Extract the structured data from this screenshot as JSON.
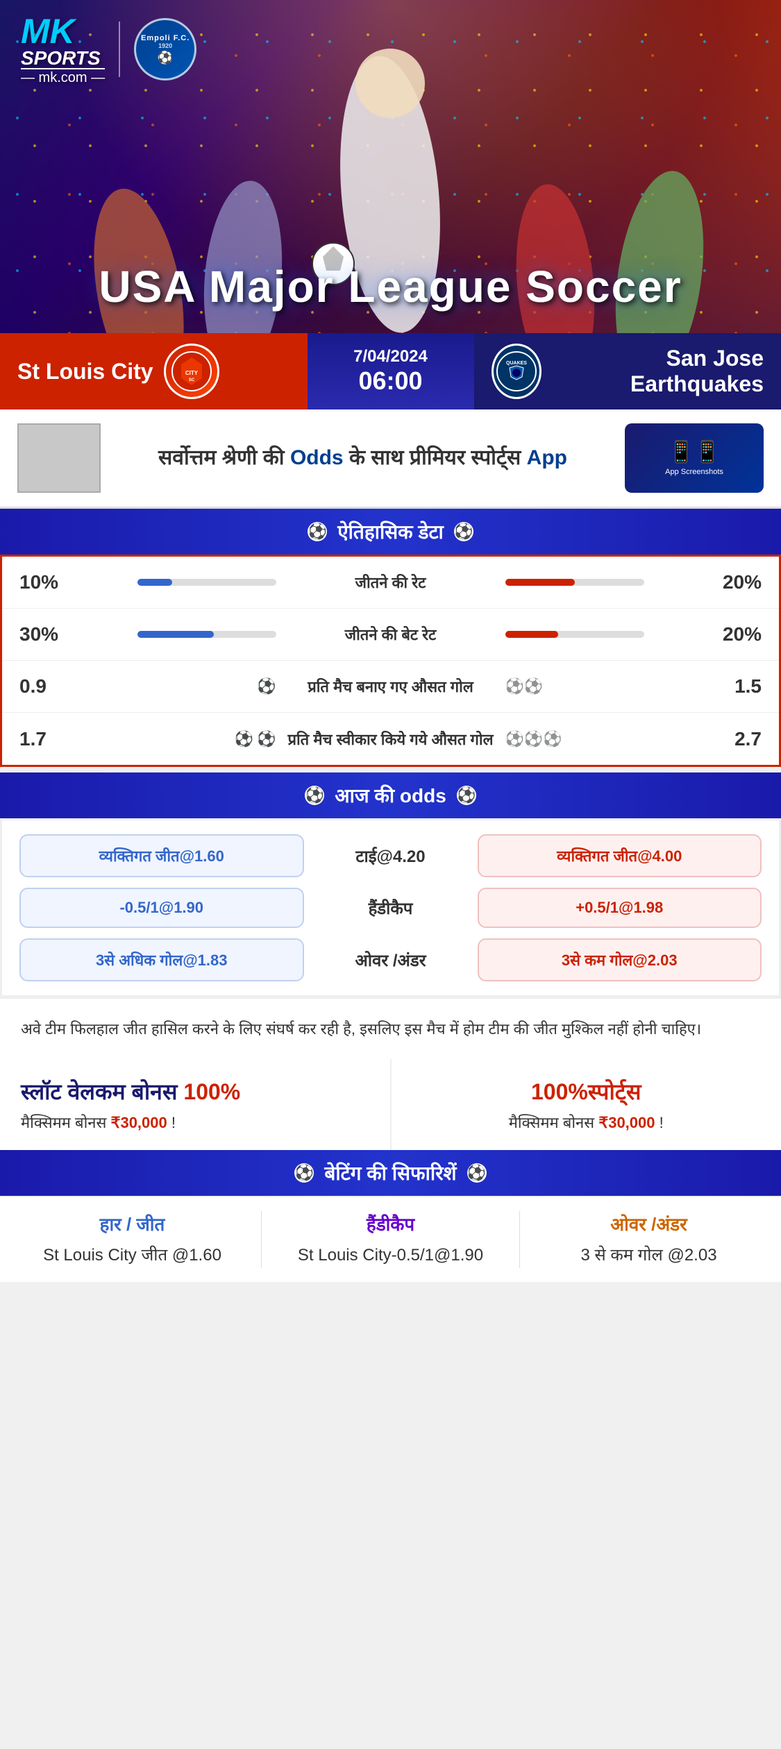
{
  "app": {
    "name": "MK Sports",
    "domain": "mk.com",
    "logo_text": "MK",
    "sports_label": "SPORTS"
  },
  "sponsor": {
    "name": "Empoli F.C.",
    "year": "1920"
  },
  "hero": {
    "title": "USA Major League Soccer"
  },
  "match": {
    "date": "7/04/2024",
    "time": "06:00",
    "home_team": "St Louis City",
    "away_team": "San Jose Earthquakes",
    "away_team_abbr": "QUAKES"
  },
  "promo": {
    "text_part1": "सर्वोत्तम श्रेणी की",
    "text_bold": "Odds",
    "text_part2": "के साथ प्रीमियर स्पोर्ट्स",
    "text_app": "App"
  },
  "historical": {
    "section_title": "ऐतिहासिक डेटा",
    "rows": [
      {
        "label": "जीतने की रेट",
        "left_val": "10%",
        "right_val": "20%",
        "left_pct": 25,
        "right_pct": 50
      },
      {
        "label": "जीतने की बेट रेट",
        "left_val": "30%",
        "right_val": "20%",
        "left_pct": 55,
        "right_pct": 38
      },
      {
        "label": "प्रति मैच बनाए गए औसत गोल",
        "left_val": "0.9",
        "right_val": "1.5",
        "left_balls": 1,
        "right_balls": 2
      },
      {
        "label": "प्रति मैच स्वीकार किये गये औसत गोल",
        "left_val": "1.7",
        "right_val": "2.7",
        "left_balls": 2,
        "right_balls": 3
      }
    ]
  },
  "odds": {
    "section_title": "आज की odds",
    "rows": [
      {
        "left": "व्यक्तिगत जीत@1.60",
        "center": "टाई@4.20",
        "right": "व्यक्तिगत जीत@4.00"
      },
      {
        "left": "-0.5/1@1.90",
        "center": "हैंडीकैप",
        "right": "+0.5/1@1.98"
      },
      {
        "left": "3से अधिक गोल@1.83",
        "center": "ओवर /अंडर",
        "right": "3से कम गोल@2.03"
      }
    ]
  },
  "info_text": "अवे टीम फिलहाल जीत हासिल करने के लिए संघर्ष कर रही है, इसलिए इस मैच में होम टीम की जीत मुश्किल नहीं होनी चाहिए।",
  "bonuses": {
    "left": {
      "title": "स्लॉट वेलकम बोनस",
      "percent": "100%",
      "subtitle": "मैक्सिमम बोनस ₹30,000  !"
    },
    "right": {
      "title": "100%स्पोर्ट्स",
      "subtitle": "मैक्सिमम बोनस  ₹30,000 !"
    }
  },
  "recommendations": {
    "section_title": "बेटिंग की सिफारिशें",
    "cols": [
      {
        "type": "हार / जीत",
        "type_color": "blue",
        "value": "St Louis City जीत @1.60"
      },
      {
        "type": "हैंडीकैप",
        "type_color": "purple",
        "value": "St Louis City-0.5/1@1.90"
      },
      {
        "type": "ओवर /अंडर",
        "type_color": "orange",
        "value": "3 से कम गोल @2.03"
      }
    ]
  }
}
